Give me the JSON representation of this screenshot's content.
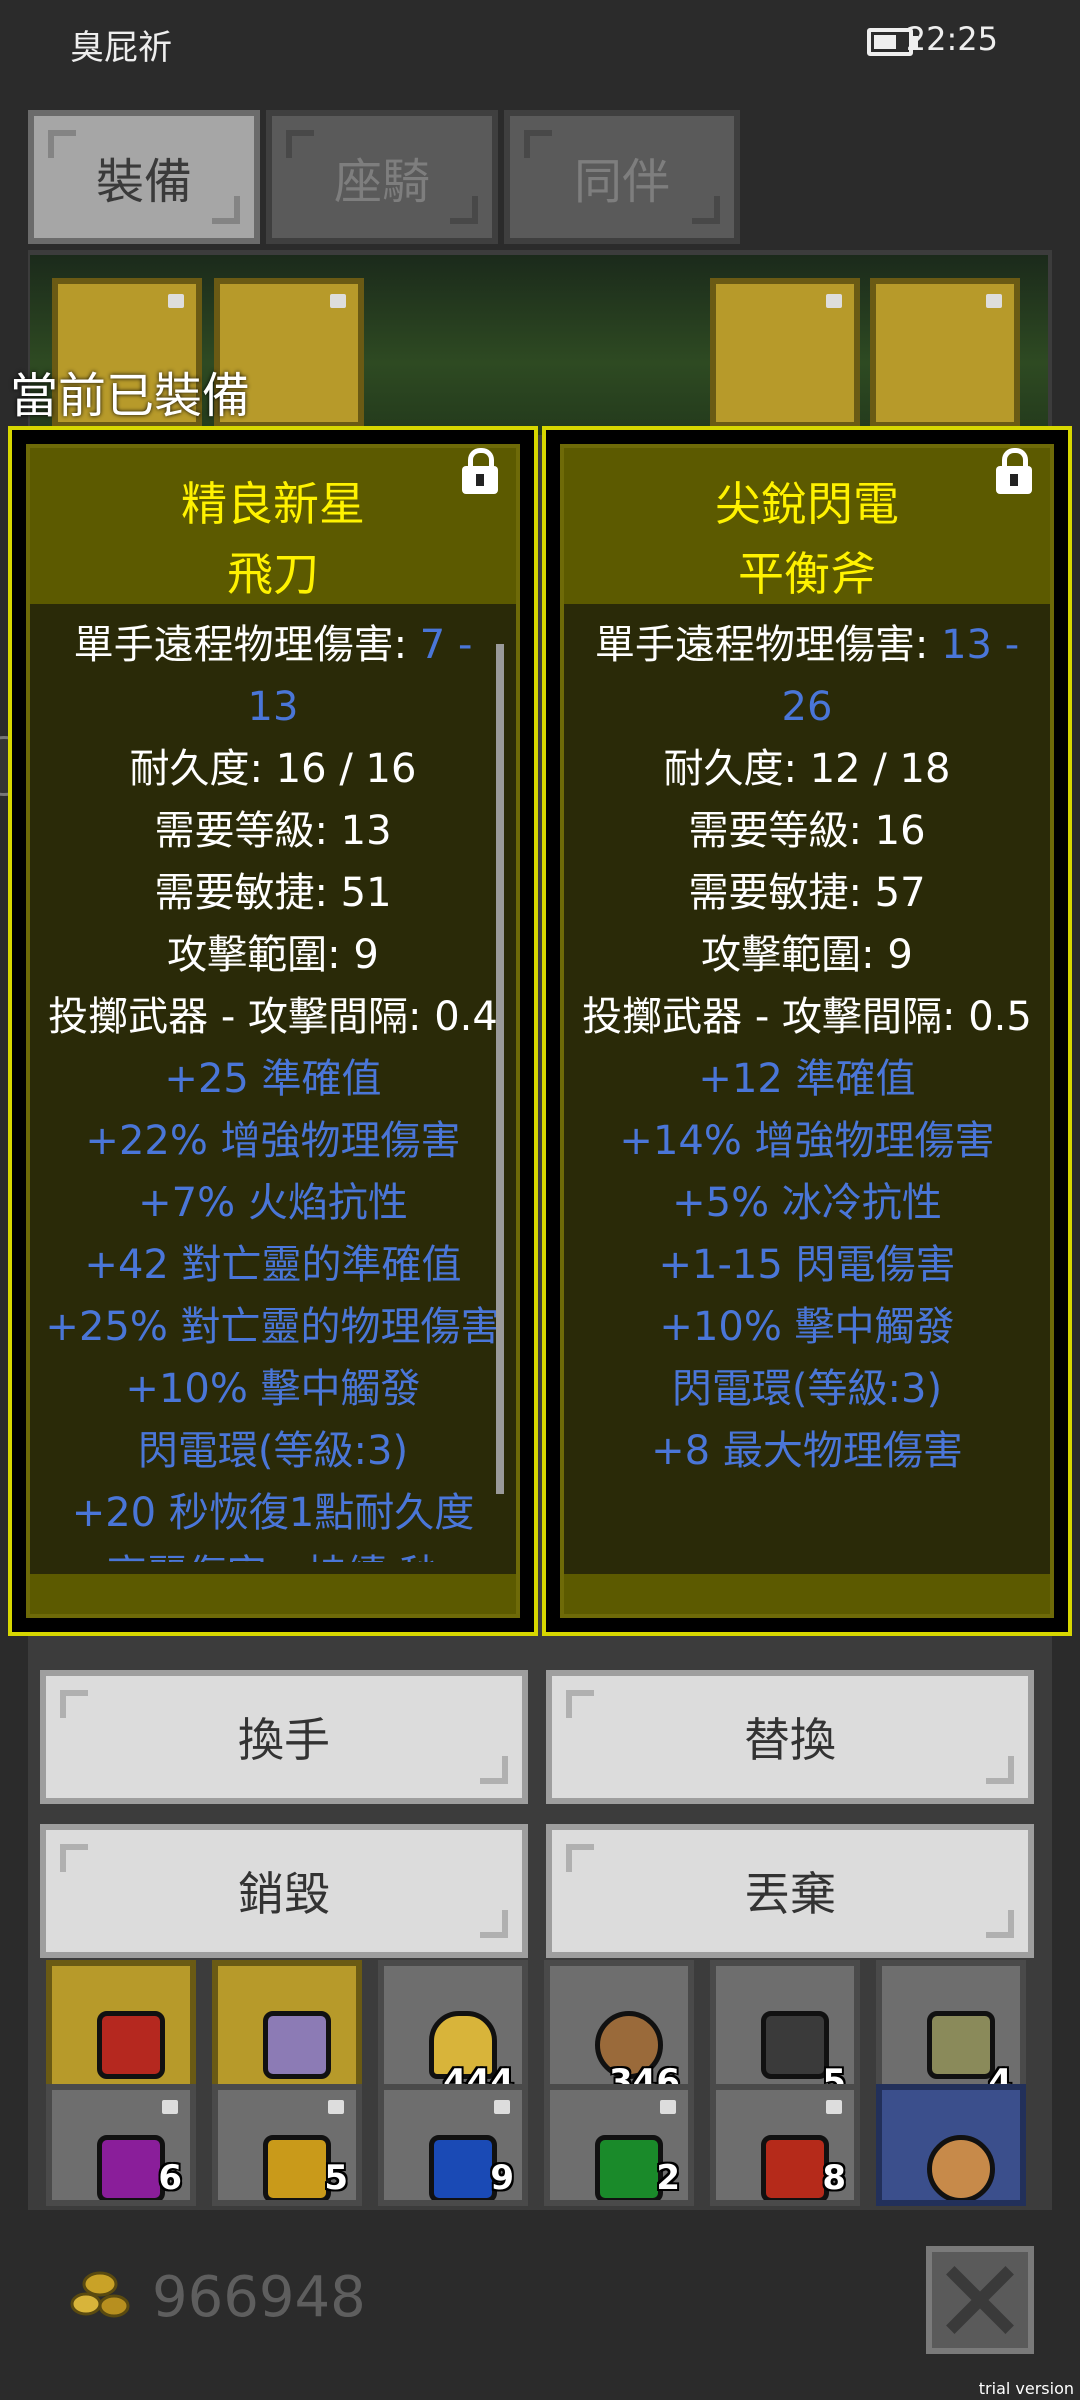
{
  "status_bar": {
    "carrier": "臭屁祈",
    "time": "22:25",
    "battery_level": 0.7
  },
  "tabs": [
    {
      "label": "裝備",
      "active": true
    },
    {
      "label": "座騎",
      "active": false
    },
    {
      "label": "同伴",
      "active": false
    }
  ],
  "equipped_label": "當前已裝備",
  "panels": [
    {
      "title_line1": "精良新星",
      "title_line2": "飛刀",
      "damage_label": "單手遠程物理傷害: ",
      "damage_value_1": "7 -",
      "damage_value_2": "13",
      "white_lines": [
        "耐久度: 16 / 16",
        "需要等級: 13",
        "需要敏捷: 51",
        "攻擊範圍: 9",
        "投擲武器 - 攻擊間隔: 0.4"
      ],
      "blue_lines": [
        "+25 準確值",
        "+22% 增強物理傷害",
        "+7% 火焰抗性",
        "+42 對亡靈的準確值",
        "+25% 對亡靈的物理傷害",
        "+10% 擊中觸發",
        "閃電環(等級:3)",
        "+20 秒恢復1點耐久度",
        "高麗傷害 - 持續 秒"
      ]
    },
    {
      "title_line1": "尖銳閃電",
      "title_line2": "平衡斧",
      "damage_label": "單手遠程物理傷害: ",
      "damage_value_1": "13 -",
      "damage_value_2": "26",
      "white_lines": [
        "耐久度: 12 / 18",
        "需要等級: 16",
        "需要敏捷: 57",
        "攻擊範圍: 9",
        "投擲武器 - 攻擊間隔: 0.5"
      ],
      "blue_lines": [
        "+12 準確值",
        "+14% 增強物理傷害",
        "+5% 冰冷抗性",
        "+1-15 閃電傷害",
        "+10% 擊中觸發",
        "閃電環(等級:3)",
        "+8 最大物理傷害"
      ]
    }
  ],
  "actions": {
    "swap_hand": "換手",
    "replace": "替換",
    "destroy": "銷毀",
    "discard": "丟棄"
  },
  "inventory_counts": [
    "444",
    "346",
    "5",
    "4",
    "6",
    "5",
    "9",
    "2",
    "8"
  ],
  "gold": "966948",
  "trial": "trial version",
  "colors": {
    "panel_border": "#d7d700",
    "title": "#fff200",
    "stat_blue": "#4a76d8"
  }
}
